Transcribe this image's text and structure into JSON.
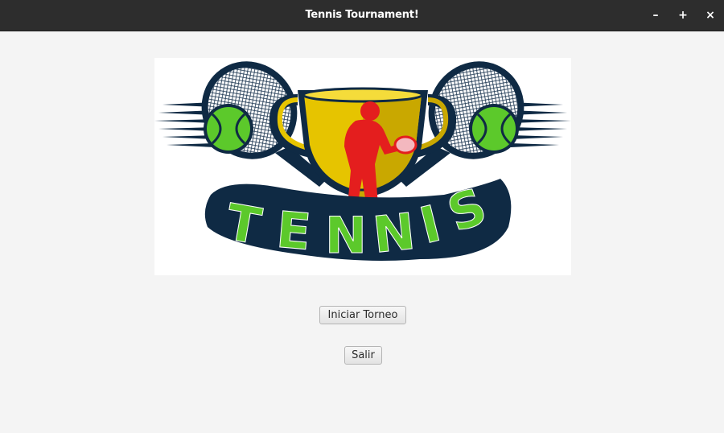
{
  "window": {
    "title": "Tennis Tournament!",
    "controls": {
      "minimize": "–",
      "maximize": "+",
      "close": "×"
    }
  },
  "logo": {
    "text": "TENNIS",
    "colors": {
      "navy": "#0f2a44",
      "green": "#5cc92b",
      "gold": "#e6c400",
      "red": "#e41e1e"
    }
  },
  "buttons": {
    "start_label": "Iniciar Torneo",
    "exit_label": "Salir"
  }
}
